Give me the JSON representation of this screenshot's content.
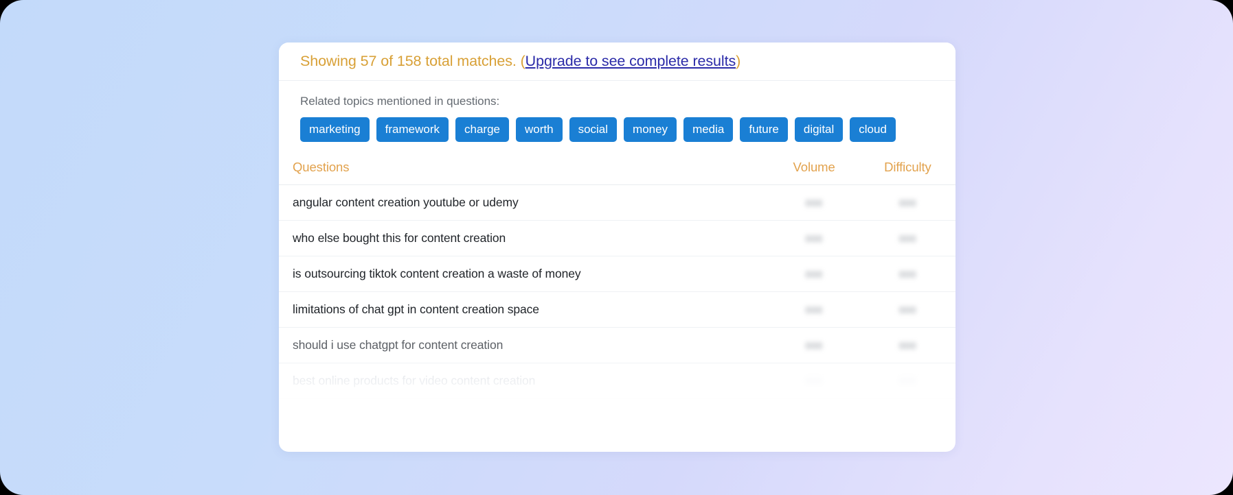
{
  "background": {
    "gradient_from": "#c3dafa",
    "gradient_to": "#ece6fe"
  },
  "card": {
    "header": {
      "showing_text": "Showing 57 of 158 total matches.",
      "open_paren": "(",
      "upgrade_link": "Upgrade to see complete results",
      "close_paren": ")",
      "accent_color": "#d8a036",
      "link_color": "#2a2aa8",
      "shown_count": 57,
      "total_count": 158
    },
    "topics": {
      "caption": "Related topics mentioned in questions:",
      "tag_color": "#1a7fd4",
      "tags": [
        "marketing",
        "framework",
        "charge",
        "worth",
        "social",
        "money",
        "media",
        "future",
        "digital",
        "cloud"
      ]
    },
    "table": {
      "header_color": "#e2a24d",
      "columns": [
        "Questions",
        "Volume",
        "Difficulty"
      ],
      "rows": [
        {
          "question": "angular content creation youtube or udemy",
          "volume": "000",
          "difficulty": "000",
          "state": "normal"
        },
        {
          "question": "who else bought this for content creation",
          "volume": "000",
          "difficulty": "000",
          "state": "normal"
        },
        {
          "question": "is outsourcing tiktok content creation a waste of money",
          "volume": "000",
          "difficulty": "000",
          "state": "normal"
        },
        {
          "question": "limitations of chat gpt in content creation space",
          "volume": "000",
          "difficulty": "000",
          "state": "normal"
        },
        {
          "question": "should i use chatgpt for content creation",
          "volume": "000",
          "difficulty": "000",
          "state": "fading"
        },
        {
          "question": "best online products for video content creation",
          "volume": "000",
          "difficulty": "000",
          "state": "faded"
        }
      ]
    }
  }
}
